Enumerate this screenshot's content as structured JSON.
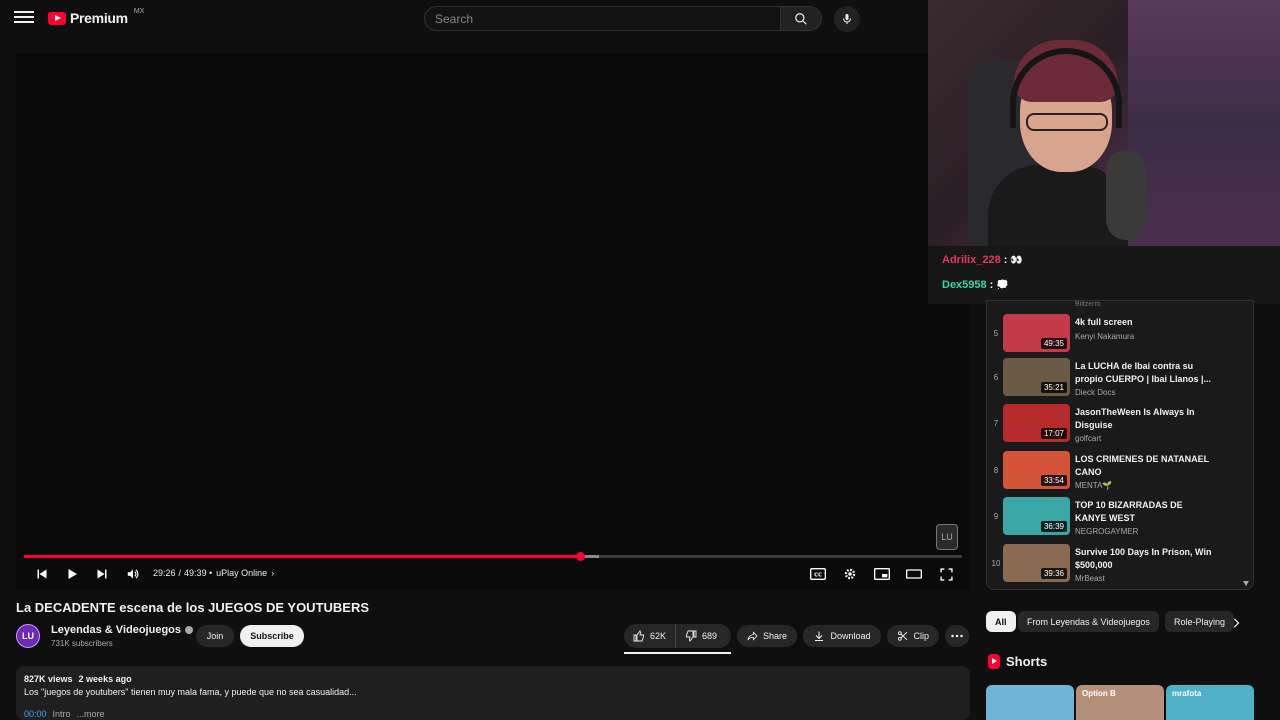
{
  "header": {
    "logo_text": "Premium",
    "region": "MX",
    "search_placeholder": "Search"
  },
  "player": {
    "current_time": "29:26",
    "separator": "/",
    "duration": "49:39",
    "chapter_prefix": "•",
    "chapter": "uPlay Online",
    "played_fraction": 0.593,
    "buffered_fraction": 0.613,
    "watermark_text": "LU"
  },
  "video": {
    "title": "La DECADENTE escena de los JUEGOS DE YOUTUBERS",
    "channel_name": "Leyendas & Videojuegos",
    "channel_avatar_text": "LU",
    "subscribers": "731K subscribers",
    "join_label": "Join",
    "subscribe_label": "Subscribe",
    "likes": "62K",
    "dislikes": "689",
    "share_label": "Share",
    "download_label": "Download",
    "clip_label": "Clip",
    "views": "827K views",
    "age": "2 weeks ago",
    "description": "Los \"juegos de youtubers\" tienen muy mala fama, y puede que no sea casualidad...",
    "first_timestamp": "00:00",
    "first_chapter": "Intro",
    "more_label": "...more"
  },
  "chat": [
    {
      "user": "Adrilix_228",
      "color": "#e8365d",
      "message": "👀"
    },
    {
      "user": "Dex5958",
      "color": "#37d6a4",
      "message": "💭"
    }
  ],
  "playlist": {
    "partial_channel": "Biltzerro",
    "items": [
      {
        "index": "5",
        "title": "4k full screen",
        "channel": "Kenyi Nakamura",
        "duration": "49:35",
        "thumb": "#c33a4b"
      },
      {
        "index": "6",
        "title": "La LUCHA de Ibai contra su propio CUERPO | Ibai Llanos |...",
        "channel": "Dieck Docs",
        "duration": "35:21",
        "thumb": "#6b5a44"
      },
      {
        "index": "7",
        "title": "JasonTheWeen Is Always In Disguise",
        "channel": "golfcart",
        "duration": "17:07",
        "thumb": "#b52a2a"
      },
      {
        "index": "8",
        "title": "LOS CRIMENES DE NATANAEL CANO",
        "channel": "MENTA🌱",
        "duration": "33:54",
        "thumb": "#d4543a"
      },
      {
        "index": "9",
        "title": "TOP 10 BIZARRADAS DE KANYE WEST",
        "channel": "NEGROGAYMER",
        "duration": "36:39",
        "thumb": "#3aa6a6"
      },
      {
        "index": "10",
        "title": "Survive 100 Days In Prison, Win $500,000",
        "channel": "MrBeast",
        "duration": "39:36",
        "thumb": "#8a6a50"
      }
    ]
  },
  "chips": [
    {
      "label": "All",
      "active": true
    },
    {
      "label": "From Leyendas & Videojuegos",
      "active": false
    },
    {
      "label": "Role-Playing",
      "active": false
    }
  ],
  "shorts": {
    "heading": "Shorts",
    "items": [
      {
        "label": "",
        "color": "#6fb3d9"
      },
      {
        "label": "Option B",
        "color": "#b48f7a"
      },
      {
        "label": "mrafota",
        "color": "#4fb0c8"
      }
    ]
  }
}
